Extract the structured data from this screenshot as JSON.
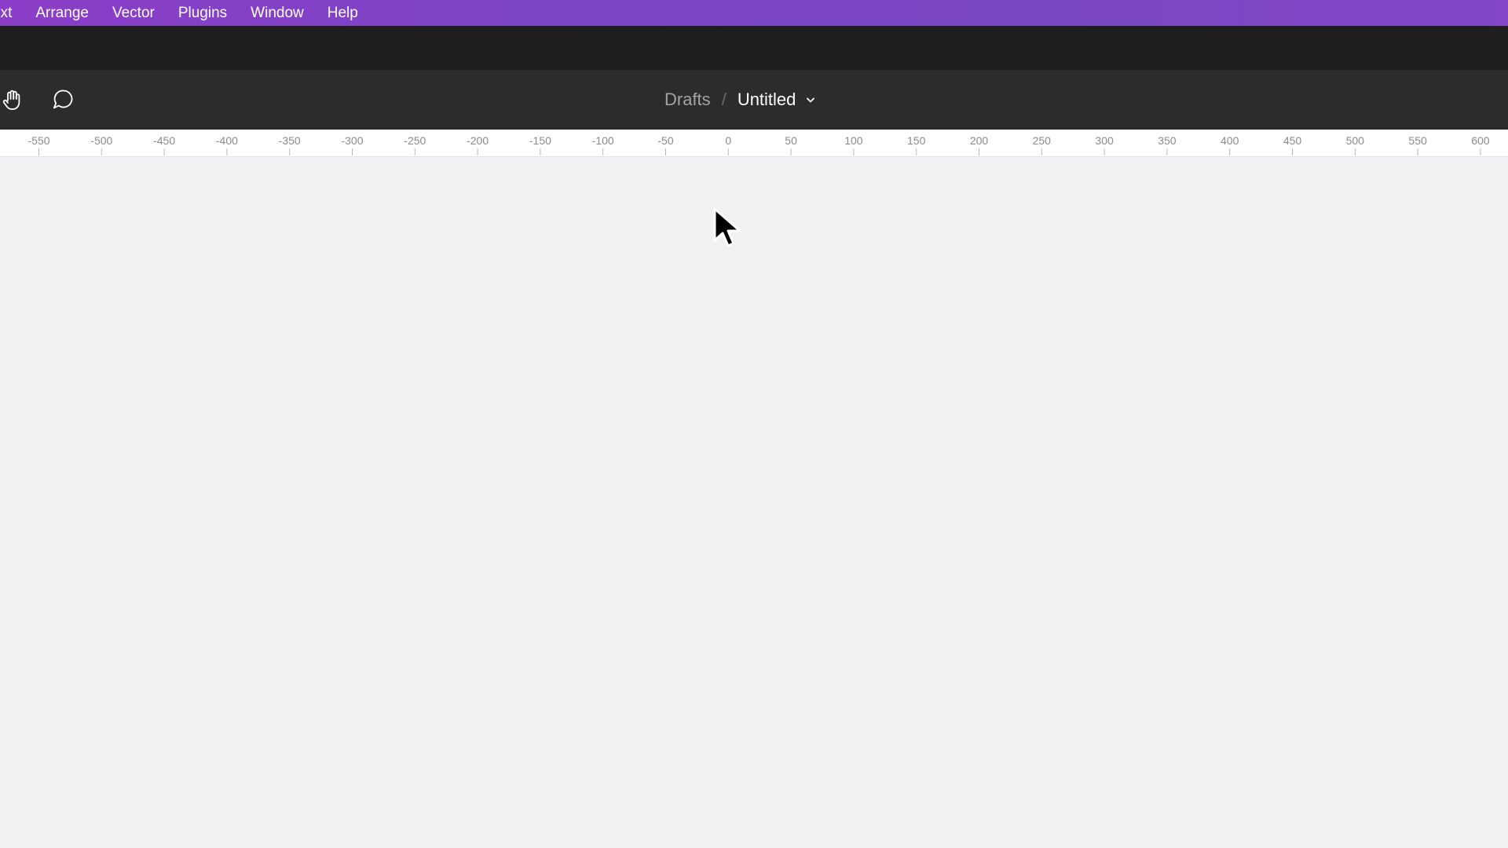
{
  "menu": {
    "items": [
      "ext",
      "Arrange",
      "Vector",
      "Plugins",
      "Window",
      "Help"
    ]
  },
  "toolbar": {
    "tools": [
      {
        "icon": "hand-icon"
      },
      {
        "icon": "comment-icon"
      }
    ],
    "breadcrumb": {
      "parent": "Drafts",
      "separator": "/",
      "title": "Untitled"
    }
  },
  "ruler": {
    "labels": [
      "-550",
      "-500",
      "-450",
      "-400",
      "-350",
      "-300",
      "-250",
      "-200",
      "-150",
      "-100",
      "-50",
      "0",
      "50",
      "100",
      "150",
      "200",
      "250",
      "300",
      "350",
      "400",
      "450",
      "500",
      "550",
      "600"
    ]
  },
  "colors": {
    "menubar": "#7c45c6",
    "toolbar": "#2c2c2c",
    "canvas": "#f1f1f3"
  }
}
